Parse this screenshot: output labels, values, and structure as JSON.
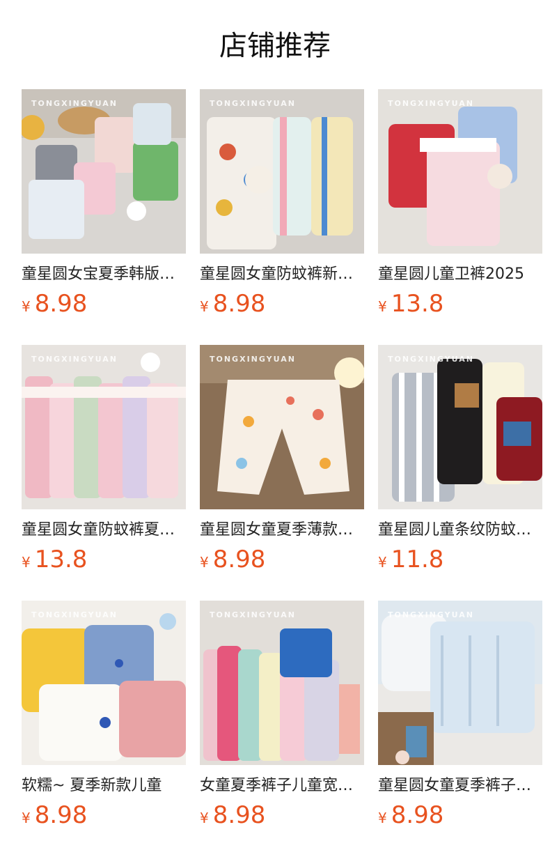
{
  "page": {
    "title": "店铺推荐"
  },
  "products": [
    {
      "name": "童星圆女宝夏季韩版…",
      "currency": "¥",
      "price": "8.98",
      "watermark": "TONGXINGYUAN"
    },
    {
      "name": "童星圆女童防蚊裤新…",
      "currency": "¥",
      "price": "8.98",
      "watermark": "TONGXINGYUAN"
    },
    {
      "name": "童星圆儿童卫裤2025",
      "currency": "¥",
      "price": "13.8",
      "watermark": "TONGXINGYUAN"
    },
    {
      "name": "童星圆女童防蚊裤夏…",
      "currency": "¥",
      "price": "13.8",
      "watermark": "TONGXINGYUAN"
    },
    {
      "name": "童星圆女童夏季薄款…",
      "currency": "¥",
      "price": "8.98",
      "watermark": "TONGXINGYUAN"
    },
    {
      "name": "童星圆儿童条纹防蚊…",
      "currency": "¥",
      "price": "11.8",
      "watermark": "TONGXINGYUAN"
    },
    {
      "name": "软糯~ 夏季新款儿童",
      "currency": "¥",
      "price": "8.98",
      "watermark": "TONGXINGYUAN"
    },
    {
      "name": "女童夏季裤子儿童宽…",
      "currency": "¥",
      "price": "8.98",
      "watermark": "TONGXINGYUAN"
    },
    {
      "name": "童星圆女童夏季裤子…",
      "currency": "¥",
      "price": "8.98",
      "watermark": "TONGXINGYUAN"
    }
  ]
}
